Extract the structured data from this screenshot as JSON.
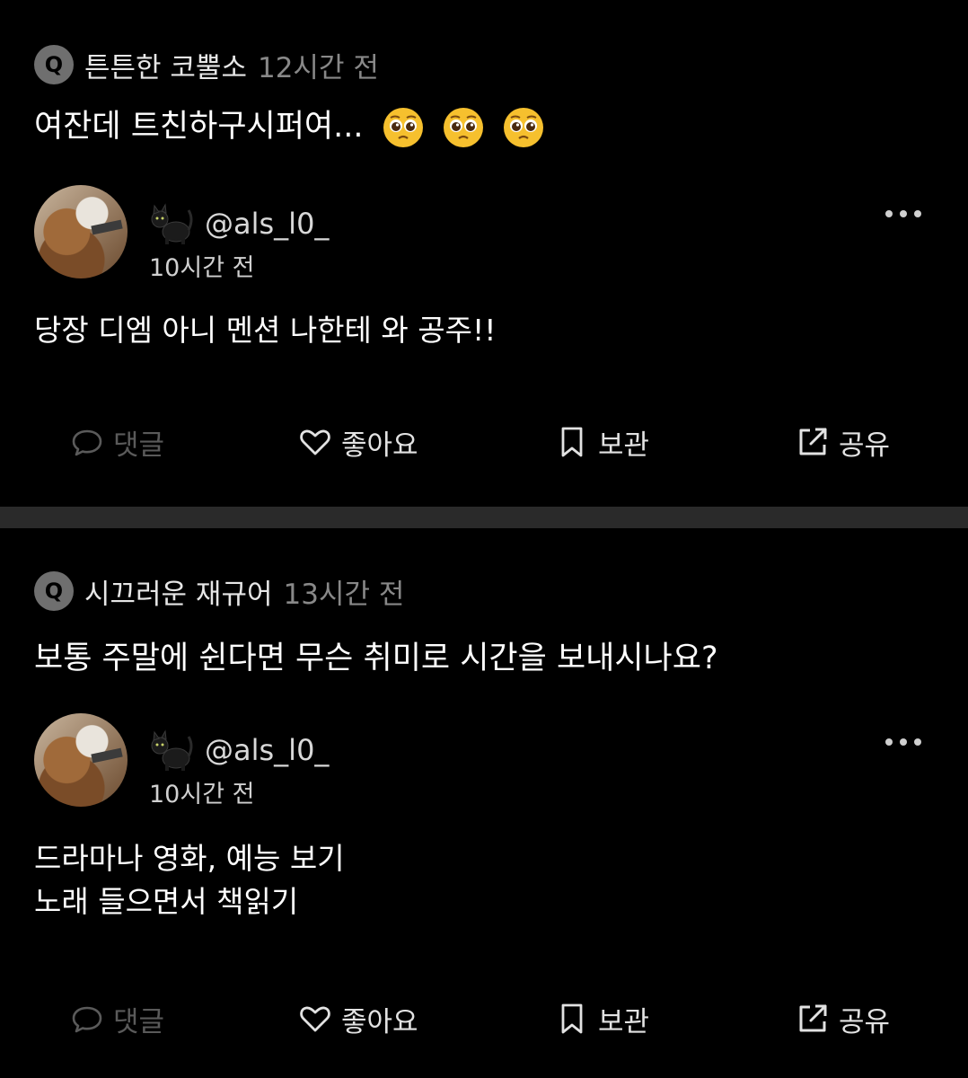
{
  "posts": [
    {
      "question": {
        "badge": "Q",
        "author": "튼튼한 코뿔소",
        "time": "12시간 전",
        "text": "여잔데 트친하구시퍼여..."
      },
      "question_emoji": [
        "pleading-face",
        "pleading-face",
        "pleading-face"
      ],
      "answer": {
        "handle": "@als_l0_",
        "time": "10시간 전",
        "lines": [
          "당장 디엠 아니 멘션 나한테 와 공주!!"
        ]
      },
      "actions": {
        "comment": "댓글",
        "like": "좋아요",
        "save": "보관",
        "share": "공유"
      }
    },
    {
      "question": {
        "badge": "Q",
        "author": "시끄러운 재규어",
        "time": "13시간 전",
        "text": "보통 주말에 쉰다면 무슨 취미로 시간을 보내시나요?"
      },
      "answer": {
        "handle": "@als_l0_",
        "time": "10시간 전",
        "lines": [
          "드라마나 영화, 예능 보기",
          "노래 들으면서 책읽기"
        ]
      },
      "actions": {
        "comment": "댓글",
        "like": "좋아요",
        "save": "보관",
        "share": "공유"
      }
    }
  ],
  "icons": {
    "q": "q-badge-icon",
    "cat": "black-cat-icon",
    "more": "more-horizontal-icon",
    "comment": "chat-bubble-icon",
    "like": "heart-icon",
    "save": "bookmark-icon",
    "share": "share-external-icon"
  },
  "colors": {
    "background": "#000000",
    "divider": "#2a2a2a",
    "muted": "#888888",
    "disabled": "#5a5a5a"
  }
}
